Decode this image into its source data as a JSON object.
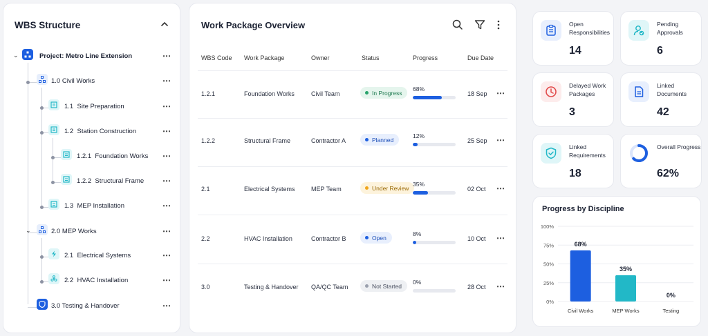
{
  "wbs": {
    "title": "WBS Structure",
    "items": [
      {
        "label": "Project: Metro Line Extension"
      },
      {
        "label": "1.0 Civil Works"
      },
      {
        "code": "1.1",
        "label": "Site Preparation"
      },
      {
        "code": "1.2",
        "label": "Station Construction"
      },
      {
        "code": "1.2.1",
        "label": "Foundation Works"
      },
      {
        "code": "1.2.2",
        "label": "Structural Frame"
      },
      {
        "code": "1.3",
        "label": "MEP Installation"
      },
      {
        "label": "2.0 MEP Works"
      },
      {
        "code": "2.1",
        "label": "Electrical Systems"
      },
      {
        "code": "2.2",
        "label": "HVAC Installation"
      },
      {
        "label": "3.0 Testing & Handover"
      }
    ]
  },
  "work_packages": {
    "title": "Work Package Overview",
    "columns": [
      "WBS Code",
      "Work Package",
      "Owner",
      "Status",
      "Progress",
      "Due Date"
    ],
    "rows": [
      {
        "code": "1.2.1",
        "name": "Foundation Works",
        "owner": "Civil Team",
        "status": "In Progress",
        "progress_label": "68%",
        "progress": 0.68,
        "due": "18 Sep"
      },
      {
        "code": "1.2.2",
        "name": "Structural Frame",
        "owner": "Contractor A",
        "status": "Planned",
        "progress_label": "12%",
        "progress": 0.12,
        "due": "25 Sep"
      },
      {
        "code": "2.1",
        "name": "Electrical Systems",
        "owner": "MEP Team",
        "status": "Under Review",
        "progress_label": "35%",
        "progress": 0.35,
        "due": "02 Oct"
      },
      {
        "code": "2.2",
        "name": "HVAC Installation",
        "owner": "Contractor B",
        "status": "Open",
        "progress_label": "8%",
        "progress": 0.08,
        "due": "10 Oct"
      },
      {
        "code": "3.0",
        "name": "Testing & Handover",
        "owner": "QA/QC Team",
        "status": "Not Started",
        "progress_label": "0%",
        "progress": 0.0,
        "due": "28 Oct"
      }
    ]
  },
  "stats": [
    {
      "label": "Open Responsibilities",
      "value": "14",
      "icon": "clipboard-list-icon"
    },
    {
      "label": "Pending Approvals",
      "value": "6",
      "icon": "user-check-icon"
    },
    {
      "label": "Delayed Work Packages",
      "value": "3",
      "icon": "clock-icon"
    },
    {
      "label": "Linked Documents",
      "value": "42",
      "icon": "document-icon"
    },
    {
      "label": "Linked Requirements",
      "value": "18",
      "icon": "shield-check-icon"
    },
    {
      "label": "Overall Progress",
      "value": "62%",
      "icon": "progress-ring-icon",
      "fraction": 0.62
    }
  ],
  "colors": {
    "accent": "#1d5fe0",
    "teal": "#22b8c7",
    "red": "#e24a4a",
    "in_progress": "#27a36b",
    "planned": "#1d5fe0",
    "under_review": "#f0a51a",
    "not_started": "#9aa0ad"
  },
  "chart_data": {
    "type": "bar",
    "title": "Progress by Discipline",
    "categories": [
      "Civil Works",
      "MEP Works",
      "Testing"
    ],
    "values": [
      68,
      35,
      0
    ],
    "value_labels": [
      "68%",
      "35%",
      "0%"
    ],
    "ylim": [
      0,
      100
    ],
    "yticks": [
      "100%",
      "75%",
      "50%",
      "25%",
      "0%"
    ],
    "bar_colors": [
      "#1d5fe0",
      "#22b8c7",
      "#22b8c7"
    ]
  }
}
